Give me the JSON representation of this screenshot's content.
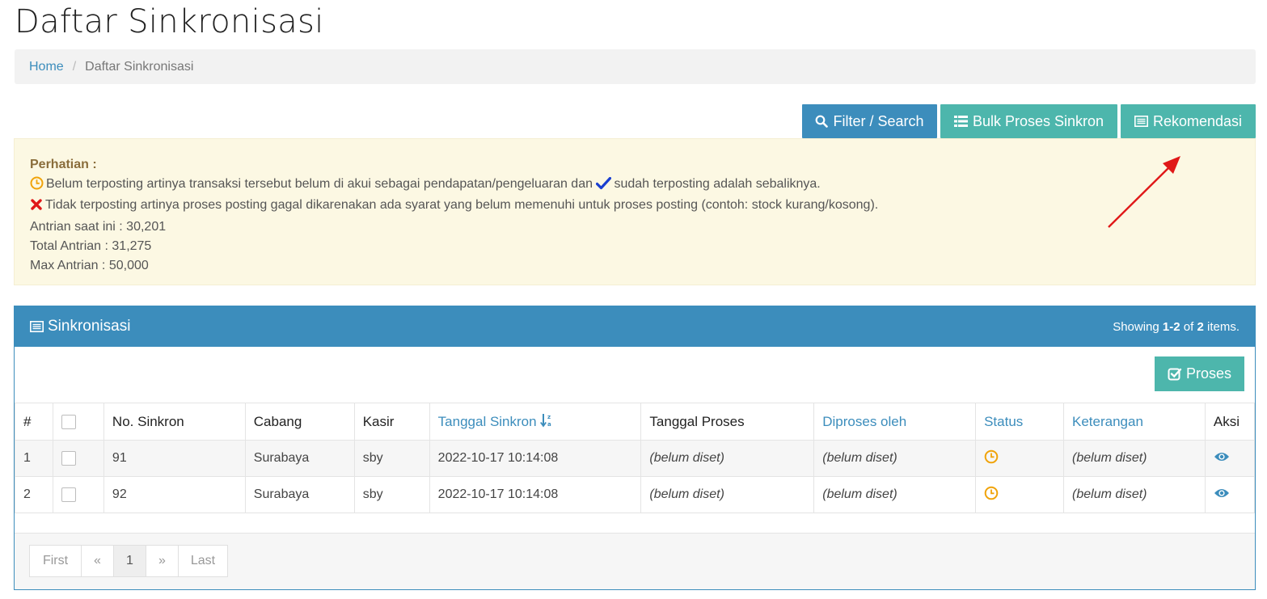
{
  "page": {
    "title": "Daftar Sinkronisasi"
  },
  "breadcrumb": {
    "home": "Home",
    "separator": "/",
    "current": "Daftar Sinkronisasi"
  },
  "toolbar": {
    "filter_label": "Filter / Search",
    "bulk_label": "Bulk Proses Sinkron",
    "rekomendasi_label": "Rekomendasi"
  },
  "notice": {
    "header": "Perhatian :",
    "line1_a": "Belum terposting artinya transaksi tersebut belum di akui sebagai pendapatan/pengeluaran dan",
    "line1_b": "sudah terposting adalah sebaliknya.",
    "line2": "Tidak terposting artinya proses posting gagal dikarenakan ada syarat yang belum memenuhi untuk proses posting (contoh: stock kurang/kosong).",
    "line3": "Antrian saat ini : 30,201",
    "line4": "Total Antrian : 31,275",
    "line5": "Max Antrian : 50,000"
  },
  "panel": {
    "title": "Sinkronisasi",
    "summary_prefix": "Showing ",
    "summary_range": "1-2",
    "summary_mid": " of ",
    "summary_total": "2",
    "summary_suffix": " items.",
    "proses_label": "Proses"
  },
  "table": {
    "headers": {
      "num": "#",
      "no_sinkron": "No. Sinkron",
      "cabang": "Cabang",
      "kasir": "Kasir",
      "tanggal_sinkron": "Tanggal Sinkron",
      "tanggal_proses": "Tanggal Proses",
      "diproses_oleh": "Diproses oleh",
      "status": "Status",
      "keterangan": "Keterangan",
      "aksi": "Aksi"
    },
    "rows": [
      {
        "num": "1",
        "no_sinkron": "91",
        "cabang": "Surabaya",
        "kasir": "sby",
        "tanggal_sinkron": "2022-10-17 10:14:08",
        "tanggal_proses": "(belum diset)",
        "diproses_oleh": "(belum diset)",
        "status": "clock-icon",
        "keterangan": "(belum diset)"
      },
      {
        "num": "2",
        "no_sinkron": "92",
        "cabang": "Surabaya",
        "kasir": "sby",
        "tanggal_sinkron": "2022-10-17 10:14:08",
        "tanggal_proses": "(belum diset)",
        "diproses_oleh": "(belum diset)",
        "status": "clock-icon",
        "keterangan": "(belum diset)"
      }
    ]
  },
  "pagination": {
    "first": "First",
    "prev": "«",
    "current": "1",
    "next": "»",
    "last": "Last"
  },
  "colors": {
    "primary": "#3c8dbc",
    "teal": "#4db6ac",
    "warning_bg": "#fcf8e3",
    "clock": "#f0a30a",
    "check": "#1a3fd0",
    "cross": "#e01818",
    "annotation_arrow": "#e01818"
  }
}
